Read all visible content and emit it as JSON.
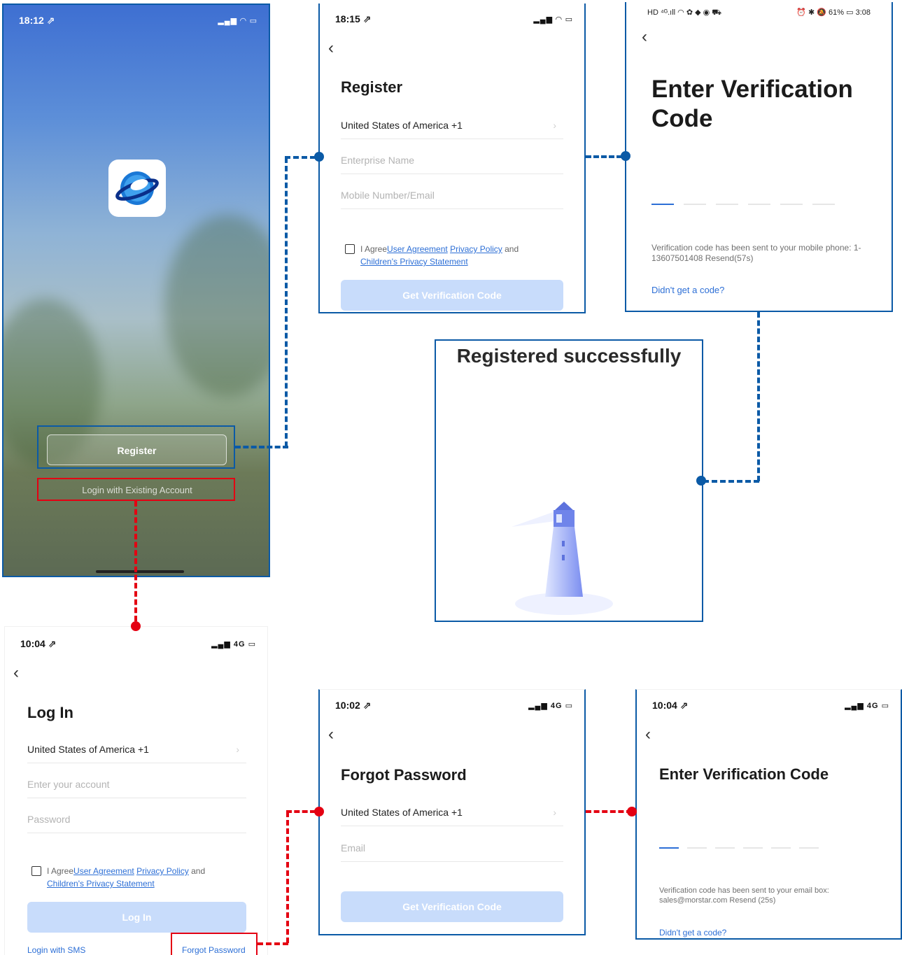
{
  "welcome": {
    "status_time": "18:12 ⇗",
    "status_icons": "▂▄▆ ◠ ▭",
    "register_label": "Register",
    "login_existing_label": "Login with Existing Account"
  },
  "register": {
    "status_time": "18:15 ⇗",
    "status_icons": "▂▄▆ ◠ ▭",
    "back": "‹",
    "title": "Register",
    "country": "United States of America +1",
    "chevron": "›",
    "enterprise_placeholder": "Enterprise Name",
    "mobile_placeholder": "Mobile Number/Email",
    "agree_prefix": "I Agree",
    "user_agreement": "User Agreement",
    "privacy_policy": "Privacy Policy",
    "and": "and",
    "childrens_privacy": "Children's Privacy Statement",
    "button": "Get Verification Code"
  },
  "verify_mobile": {
    "status_left": "HD ⁴ᴳ.ıll ◠ ✿ ◆ ◉ ⛟",
    "status_right": "⏰ ✱ 🔕 61% ▭ 3:08",
    "back": "‹",
    "title": "Enter Verification Code",
    "info": "Verification code has been sent to your mobile phone: 1-13607501408  Resend(57s)",
    "link": "Didn't get a code?"
  },
  "success": {
    "title": "Registered successfully"
  },
  "login": {
    "status_time": "10:04 ⇗",
    "status_icons": "▂▄▆ 4G ▭",
    "back": "‹",
    "title": "Log In",
    "country": "United States of America +1",
    "chevron": "›",
    "account_placeholder": "Enter your account",
    "password_placeholder": "Password",
    "agree_prefix": "I Agree",
    "user_agreement": "User Agreement",
    "privacy_policy": "Privacy Policy",
    "and": "and",
    "childrens_privacy": "Children's Privacy Statement",
    "button": "Log In",
    "login_sms": "Login with SMS",
    "forgot": "Forgot Password"
  },
  "forgot": {
    "status_time": "10:02 ⇗",
    "status_icons": "▂▄▆ 4G ▭",
    "back": "‹",
    "title": "Forgot Password",
    "country": "United States of America +1",
    "chevron": "›",
    "email_placeholder": "Email",
    "button": "Get Verification Code"
  },
  "verify_email": {
    "status_time": "10:04 ⇗",
    "status_icons": "▂▄▆ 4G ▭",
    "back": "‹",
    "title": "Enter Verification Code",
    "info": "Verification code has been sent to your email box: sales@morstar.com  Resend (25s)",
    "link": "Didn't get a code?"
  },
  "colors": {
    "flow_blue": "#0b5aa6",
    "flow_red": "#e40012",
    "link_blue": "#2d6fd6",
    "button_disabled": "#c8dcfb"
  },
  "icons": [
    "back-chevron-icon",
    "checkbox-icon",
    "app-logo-icon",
    "lighthouse-icon",
    "signal-icon",
    "wifi-icon",
    "battery-icon"
  ]
}
